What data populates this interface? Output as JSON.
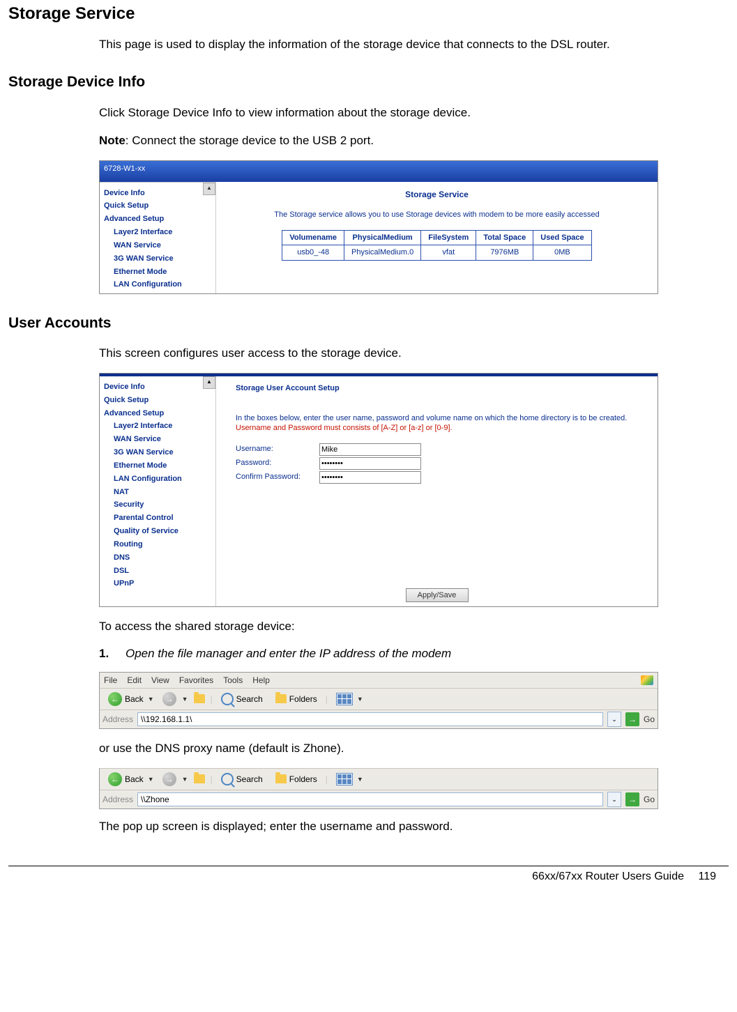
{
  "doc": {
    "h1": "Storage Service",
    "intro": "This page is used to display the information of the storage device that connects to the DSL router.",
    "h2a": "Storage Device Info",
    "p_click": "Click Storage Device Info to view information about the storage device.",
    "note_label": "Note",
    "note_text": ": Connect the storage device to the USB 2 port.",
    "h2b": "User Accounts",
    "p_user": "This screen configures user access to the storage device.",
    "p_access": "To access the shared storage device:",
    "step1_num": "1.",
    "step1_txt": "Open the file manager and enter the IP address of the modem",
    "p_or": "or use the DNS proxy name (default is Zhone).",
    "p_popup": "The pop up screen is displayed; enter the username and password.",
    "footer_title": "66xx/67xx Router Users Guide",
    "footer_page": "119"
  },
  "shot1": {
    "titlebar": "6728-W1-xx",
    "nav": [
      "Device Info",
      "Quick Setup",
      "Advanced Setup"
    ],
    "nav_sub": [
      "Layer2 Interface",
      "WAN Service",
      "3G WAN Service",
      "Ethernet Mode",
      "LAN Configuration"
    ],
    "heading": "Storage Service",
    "desc": "The Storage service allows you to use Storage devices with modem to be more easily accessed",
    "table": {
      "headers": [
        "Volumename",
        "PhysicalMedium",
        "FileSystem",
        "Total Space",
        "Used Space"
      ],
      "row": [
        "usb0_-48",
        "PhysicalMedium.0",
        "vfat",
        "7976MB",
        "0MB"
      ]
    }
  },
  "shot2": {
    "nav": [
      "Device Info",
      "Quick Setup",
      "Advanced Setup"
    ],
    "nav_sub": [
      "Layer2 Interface",
      "WAN Service",
      "3G WAN Service",
      "Ethernet Mode",
      "LAN Configuration",
      "NAT",
      "Security",
      "Parental Control",
      "Quality of Service",
      "Routing",
      "DNS",
      "DSL",
      "UPnP"
    ],
    "title": "Storage User Account Setup",
    "intro": "In the boxes below, enter the user name, password and volume name on which the home directory is to be created.",
    "warn": "Username and Password must consists of [A-Z] or [a-z] or [0-9].",
    "lbl_user": "Username:",
    "lbl_pass": "Password:",
    "lbl_conf": "Confirm Password:",
    "val_user": "Mike",
    "val_pass": "••••••••",
    "val_conf": "••••••••",
    "btn": "Apply/Save"
  },
  "explorer": {
    "menu": [
      "File",
      "Edit",
      "View",
      "Favorites",
      "Tools",
      "Help"
    ],
    "back": "Back",
    "search": "Search",
    "folders": "Folders",
    "addr_label": "Address",
    "addr1_value": "\\\\192.168.1.1\\",
    "addr2_value": "\\\\Zhone",
    "go": "Go"
  }
}
